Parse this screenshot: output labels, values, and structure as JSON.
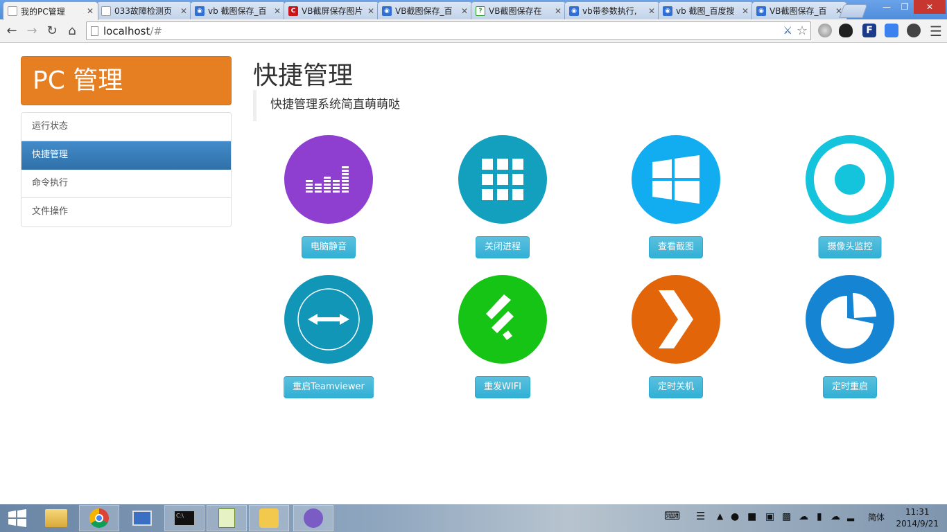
{
  "browser": {
    "tabs": [
      {
        "title": "我的PC管理",
        "favicon": "page",
        "active": true
      },
      {
        "title": "033故障检测页",
        "favicon": "page"
      },
      {
        "title": "vb 截图保存_百",
        "favicon": "paw"
      },
      {
        "title": "VB截屏保存图片",
        "favicon": "csdn"
      },
      {
        "title": "VB截图保存_百",
        "favicon": "paw"
      },
      {
        "title": "VB截图保存在",
        "favicon": "q"
      },
      {
        "title": "vb带参数执行,",
        "favicon": "paw"
      },
      {
        "title": "vb 截图_百度搜",
        "favicon": "paw"
      },
      {
        "title": "VB截图保存_百",
        "favicon": "paw"
      }
    ],
    "url_host": "localhost",
    "url_rest": "/#"
  },
  "sidebar": {
    "brand": "PC 管理",
    "items": [
      {
        "label": "运行状态"
      },
      {
        "label": "快捷管理"
      },
      {
        "label": "命令执行"
      },
      {
        "label": "文件操作"
      }
    ],
    "active_index": 1
  },
  "main": {
    "title": "快捷管理",
    "subtitle": "快捷管理系统简直萌萌哒",
    "tiles": [
      {
        "label": "电脑静音",
        "icon": "equalizer-icon",
        "color": "#8e3fcf"
      },
      {
        "label": "关闭进程",
        "icon": "grid-icon",
        "color": "#13a0be"
      },
      {
        "label": "查看截图",
        "icon": "windows-icon",
        "color": "#12acf0"
      },
      {
        "label": "摄像头监控",
        "icon": "camera-icon",
        "color": "#14c4dc"
      },
      {
        "label": "重启Teamviewer",
        "icon": "teamviewer-icon",
        "color": "#1296b8"
      },
      {
        "label": "重发WIFI",
        "icon": "feedly-icon",
        "color": "#16c415"
      },
      {
        "label": "定时关机",
        "icon": "chevron-right-icon",
        "color": "#e2650a"
      },
      {
        "label": "定时重启",
        "icon": "pie-chart-icon",
        "color": "#1585d3"
      }
    ]
  },
  "taskbar": {
    "ime": "简体",
    "time": "11:31",
    "date": "2014/9/21"
  }
}
